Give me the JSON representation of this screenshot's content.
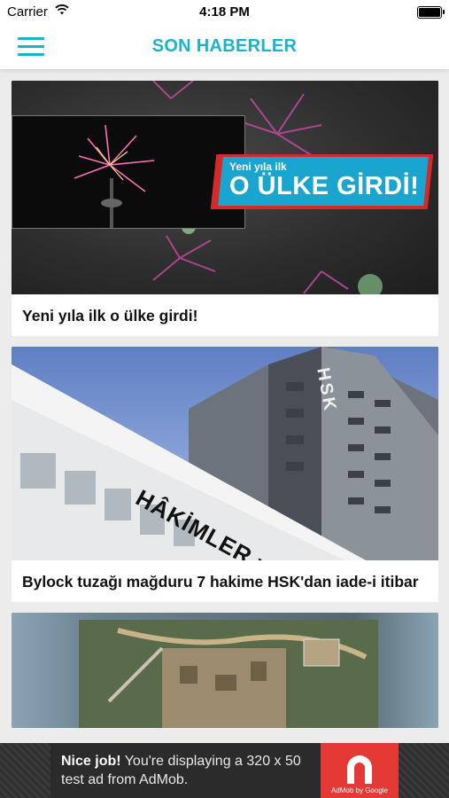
{
  "status_bar": {
    "carrier": "Carrier",
    "time": "4:18 PM"
  },
  "nav": {
    "title": "SON HABERLER",
    "menu_icon": "hamburger-menu-icon",
    "accent_color": "#1ab3c9"
  },
  "articles": [
    {
      "title": "Yeni yıla ilk o ülke girdi!",
      "image_overlay_small": "Yeni yıla ilk",
      "image_overlay_big": "O ÜLKE GİRDİ!"
    },
    {
      "title": "Bylock tuzağı mağduru 7 hakime HSK'dan iade-i itibar",
      "image_sign_text": "HÂKİMLER ve SA",
      "image_tower_text": "HSK"
    },
    {
      "title": ""
    }
  ],
  "ad": {
    "bold": "Nice job!",
    "text": " You're displaying a 320 x 50 test ad from AdMob.",
    "brand": "AdMob by Google"
  }
}
